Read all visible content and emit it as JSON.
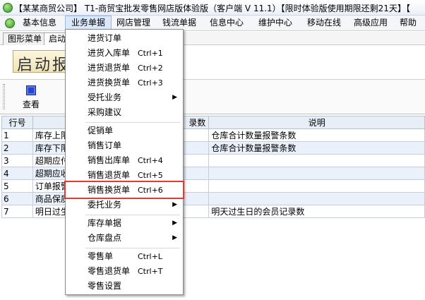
{
  "titlebar": {
    "title": "【某某商贸公司】 T1-商贸宝批发零售网店版体验版（客户端 V 11.1）【限时体验版使用期限还剩21天】【"
  },
  "menubar": {
    "items": [
      "基本信息",
      "业务单据",
      "网店管理",
      "钱流单据",
      "信息中心",
      "维护中心",
      "移动在线",
      "高级应用",
      "帮助"
    ]
  },
  "tabs": [
    "图形菜单",
    "启动"
  ],
  "banner": {
    "text": "启动报"
  },
  "toolbar": {
    "query_label": "查看"
  },
  "grid": {
    "headers": [
      "行号",
      "",
      "录数",
      "说明"
    ],
    "rows": [
      {
        "num": "1",
        "name": "库存上限",
        "desc": "仓库合计数量报警条数"
      },
      {
        "num": "2",
        "name": "库存下限",
        "desc": "仓库合计数量报警条数"
      },
      {
        "num": "3",
        "name": "超期应付",
        "desc": ""
      },
      {
        "num": "4",
        "name": "超期应收",
        "desc": ""
      },
      {
        "num": "5",
        "name": "订单报警",
        "desc": ""
      },
      {
        "num": "6",
        "name": "商品保质",
        "desc": ""
      },
      {
        "num": "7",
        "name": "明日过生",
        "desc": "明天过生日的会员记录数"
      }
    ]
  },
  "dropdown": {
    "items": [
      {
        "label": "进货订单",
        "shortcut": ""
      },
      {
        "label": "进货入库单",
        "shortcut": "Ctrl+1"
      },
      {
        "label": "进货退货单",
        "shortcut": "Ctrl+2"
      },
      {
        "label": "进货换货单",
        "shortcut": "Ctrl+3"
      },
      {
        "label": "受托业务",
        "shortcut": "",
        "submenu": true
      },
      {
        "label": "采购建议",
        "shortcut": ""
      },
      {
        "label": "促销单",
        "shortcut": ""
      },
      {
        "label": "销售订单",
        "shortcut": ""
      },
      {
        "label": "销售出库单",
        "shortcut": "Ctrl+4"
      },
      {
        "label": "销售退货单",
        "shortcut": "Ctrl+5"
      },
      {
        "label": "销售换货单",
        "shortcut": "Ctrl+6"
      },
      {
        "label": "委托业务",
        "shortcut": "",
        "submenu": true
      },
      {
        "label": "库存单据",
        "shortcut": "",
        "submenu": true
      },
      {
        "label": "仓库盘点",
        "shortcut": "",
        "submenu": true
      },
      {
        "label": "零售单",
        "shortcut": "Ctrl+L"
      },
      {
        "label": "零售退货单",
        "shortcut": "Ctrl+T"
      },
      {
        "label": "零售设置",
        "shortcut": ""
      }
    ]
  },
  "colors": {
    "highlight_box": "#e53935",
    "alt_row": "#eaf1fb",
    "active_menu": "#dbe8fb"
  }
}
